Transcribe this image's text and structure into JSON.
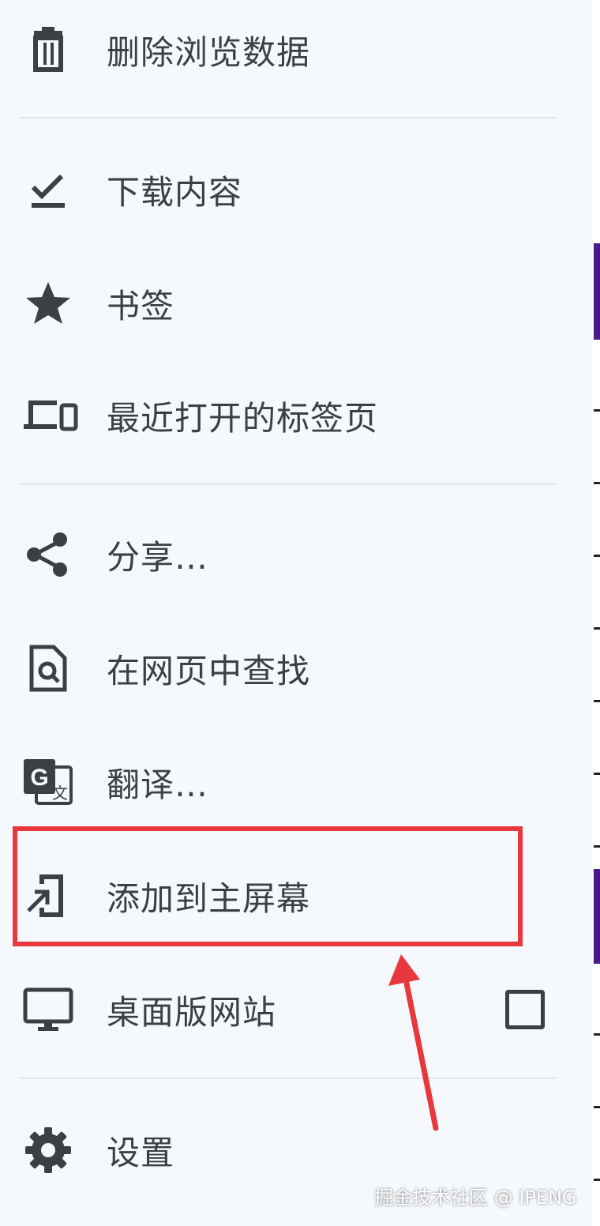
{
  "menu": {
    "items": [
      {
        "id": "clear",
        "label": "删除浏览数据",
        "icon": "trash-icon"
      },
      {
        "id": "downloads",
        "label": "下载内容",
        "icon": "download-done-icon"
      },
      {
        "id": "bookmarks",
        "label": "书签",
        "icon": "star-icon"
      },
      {
        "id": "recent",
        "label": "最近打开的标签页",
        "icon": "devices-icon"
      },
      {
        "id": "share",
        "label": "分享…",
        "icon": "share-icon"
      },
      {
        "id": "find",
        "label": "在网页中查找",
        "icon": "find-in-page-icon"
      },
      {
        "id": "translate",
        "label": "翻译…",
        "icon": "translate-icon"
      },
      {
        "id": "addhome",
        "label": "添加到主屏幕",
        "icon": "add-to-home-icon"
      },
      {
        "id": "desktop",
        "label": "桌面版网站",
        "icon": "desktop-icon",
        "checked": false
      },
      {
        "id": "settings",
        "label": "设置",
        "icon": "gear-icon"
      }
    ]
  },
  "annotation": {
    "highlight_color": "#e8383d",
    "highlighted_item": "添加到主屏幕"
  },
  "watermark": "掘金技术社区 @ IPENG"
}
